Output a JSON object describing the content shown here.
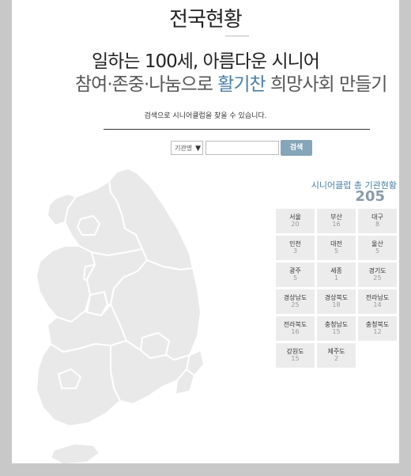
{
  "header": {
    "title": "전국현황",
    "slogan_line1": "일하는 100세, 아름다운 시니어",
    "slogan_line2_part1": "참여·존중·나눔으로",
    "slogan_line2_part2": "활기찬",
    "slogan_line2_part3": "희망사회 만들기"
  },
  "search": {
    "hint": "검색으로 시니어클럽을 찾을 수 있습니다.",
    "select_label": "기관명",
    "input_value": "",
    "button_label": "검색"
  },
  "stats": {
    "total_label": "시니어클럽 총 기관현황",
    "total_count": "205",
    "regions": [
      {
        "name": "서울",
        "count": "20"
      },
      {
        "name": "부산",
        "count": "16"
      },
      {
        "name": "대구",
        "count": "8"
      },
      {
        "name": "인천",
        "count": "3"
      },
      {
        "name": "대전",
        "count": "5"
      },
      {
        "name": "울산",
        "count": "5"
      },
      {
        "name": "광주",
        "count": "5"
      },
      {
        "name": "세종",
        "count": "1"
      },
      {
        "name": "경기도",
        "count": "25"
      },
      {
        "name": "경상남도",
        "count": "25"
      },
      {
        "name": "경상북도",
        "count": "18"
      },
      {
        "name": "전라남도",
        "count": "14"
      },
      {
        "name": "전라북도",
        "count": "16"
      },
      {
        "name": "충청남도",
        "count": "15"
      },
      {
        "name": "충청북도",
        "count": "12"
      },
      {
        "name": "강원도",
        "count": "15"
      },
      {
        "name": "제주도",
        "count": "2"
      }
    ]
  },
  "colors": {
    "accent": "#4a7fa8",
    "map_fill": "#e9e9e9",
    "button_bg": "#85a5b8",
    "cell_bg": "#ececec"
  }
}
